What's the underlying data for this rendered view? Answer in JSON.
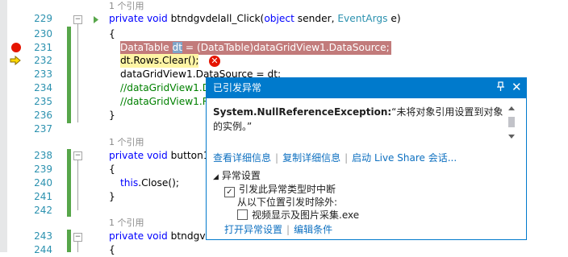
{
  "editor": {
    "lines": [
      {
        "num": "",
        "codelens": "1 个引用"
      },
      {
        "num": "229"
      },
      {
        "num": "230"
      },
      {
        "num": "231"
      },
      {
        "num": "232"
      },
      {
        "num": "233"
      },
      {
        "num": "234"
      },
      {
        "num": "235"
      },
      {
        "num": "236"
      },
      {
        "num": "237"
      },
      {
        "num": "",
        "codelens": "1 个引用"
      },
      {
        "num": "238"
      },
      {
        "num": "239"
      },
      {
        "num": "240"
      },
      {
        "num": "241"
      },
      {
        "num": "242"
      },
      {
        "num": "",
        "codelens": "1 个引用"
      },
      {
        "num": "243"
      },
      {
        "num": "244"
      }
    ],
    "code": {
      "l229_kw": "private void ",
      "l229_name": "btndgvdelall_Click(",
      "l229_kw2": "object",
      "l229_rest1": " sender, ",
      "l229_type": "EventArgs",
      "l229_rest2": " e)",
      "l230": "{",
      "l231_a": "DataTable ",
      "l231_b": "dt",
      "l231_c": " = (DataTable)dataGridView1.DataSource;",
      "l232": "dt.Rows.Clear();",
      "l233": "dataGridView1.DataSource = dt;",
      "l234": "//dataGridView1.D",
      "l235": "//dataGridView1.R",
      "l236": "}",
      "l238_kw": "private void ",
      "l238_name": "button1_",
      "l239": "{",
      "l240_kw": "this",
      "l240_rest": ".Close();",
      "l241": "}",
      "l243_kw": "private void ",
      "l243_name": "btndgvde",
      "l244": "{"
    }
  },
  "exception_popup": {
    "title": "已引发异常",
    "pin_icon": "pin-icon",
    "close_icon": "close-icon",
    "exception_type": "System.NullReferenceException:",
    "exception_message": "“未将对象引用设置到对象的实例。”",
    "links": {
      "view_details": "查看详细信息",
      "copy_details": "复制详细信息",
      "live_share": "启动 Live Share 会话..."
    },
    "settings": {
      "section_label": "异常设置",
      "break_when_thrown": "引发此异常类型时中断",
      "break_when_thrown_checked": true,
      "except_from_label": "从以下位置引发时除外:",
      "except_item": "视频显示及图片采集.exe",
      "except_item_checked": false,
      "open_settings": "打开异常设置",
      "edit_conditions": "编辑条件"
    }
  },
  "colors": {
    "accent": "#007acc",
    "error": "#e51400",
    "error_line_bg": "#c27b7b",
    "current_line_bg": "#fff5a5",
    "keyword": "#0000ff",
    "type": "#2b91af",
    "comment": "#008000"
  }
}
